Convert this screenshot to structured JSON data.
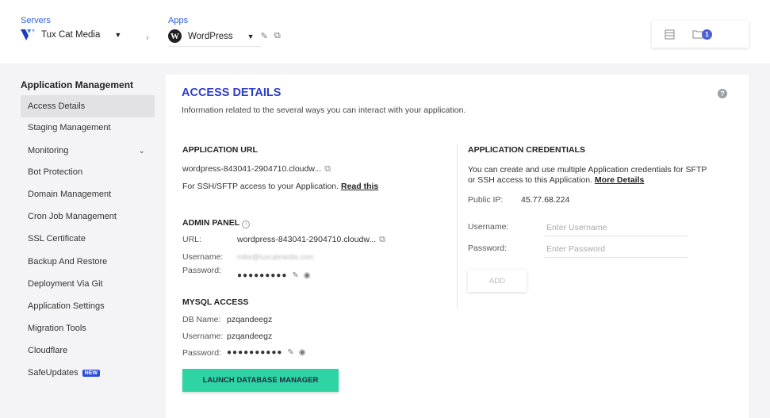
{
  "header": {
    "servers_label": "Servers",
    "server_name": "Tux Cat Media",
    "apps_label": "Apps",
    "app_name": "WordPress",
    "notification_count": "1"
  },
  "sidebar": {
    "title": "Application Management",
    "items": [
      {
        "label": "Access Details",
        "active": true
      },
      {
        "label": "Staging Management"
      },
      {
        "label": "Monitoring"
      },
      {
        "label": "Bot Protection"
      },
      {
        "label": "Domain Management"
      },
      {
        "label": "Cron Job Management"
      },
      {
        "label": "SSL Certificate"
      },
      {
        "label": "Backup And Restore"
      },
      {
        "label": "Deployment Via Git"
      },
      {
        "label": "Application Settings"
      },
      {
        "label": "Migration Tools"
      },
      {
        "label": "Cloudflare"
      },
      {
        "label": "SafeUpdates"
      }
    ],
    "new_badge": "NEW"
  },
  "main": {
    "title": "ACCESS DETAILS",
    "description": "Information related to the several ways you can interact with your application.",
    "app_url": {
      "title": "APPLICATION URL",
      "url": "wordpress-843041-2904710.cloudw...",
      "ssh_text": "For SSH/SFTP access to your Application.",
      "ssh_link": "Read this"
    },
    "admin_panel": {
      "title": "ADMIN PANEL",
      "url_label": "URL:",
      "url": "wordpress-843041-2904710.cloudw...",
      "username_label": "Username:",
      "username_blurred": "mike@tuxcatmedia.com",
      "password_label": "Password:",
      "password_mask": "●●●●●●●●●"
    },
    "mysql": {
      "title": "MYSQL ACCESS",
      "db_label": "DB Name:",
      "db_name": "pzqandeegz",
      "username_label": "Username:",
      "username": "pzqandeegz",
      "password_label": "Password:",
      "password_mask": "●●●●●●●●●●"
    },
    "launch_button": "LAUNCH DATABASE MANAGER",
    "credentials": {
      "title": "APPLICATION CREDENTIALS",
      "desc_line1": "You can create and use multiple Application credentials for SFTP",
      "desc_line2": "or SSH access to this Application.",
      "more_link": "More Details",
      "public_ip_label": "Public IP:",
      "public_ip": "45.77.68.224",
      "username_label": "Username:",
      "username_placeholder": "Enter Username",
      "password_label": "Password:",
      "password_placeholder": "Enter Password",
      "add_button": "ADD"
    }
  }
}
